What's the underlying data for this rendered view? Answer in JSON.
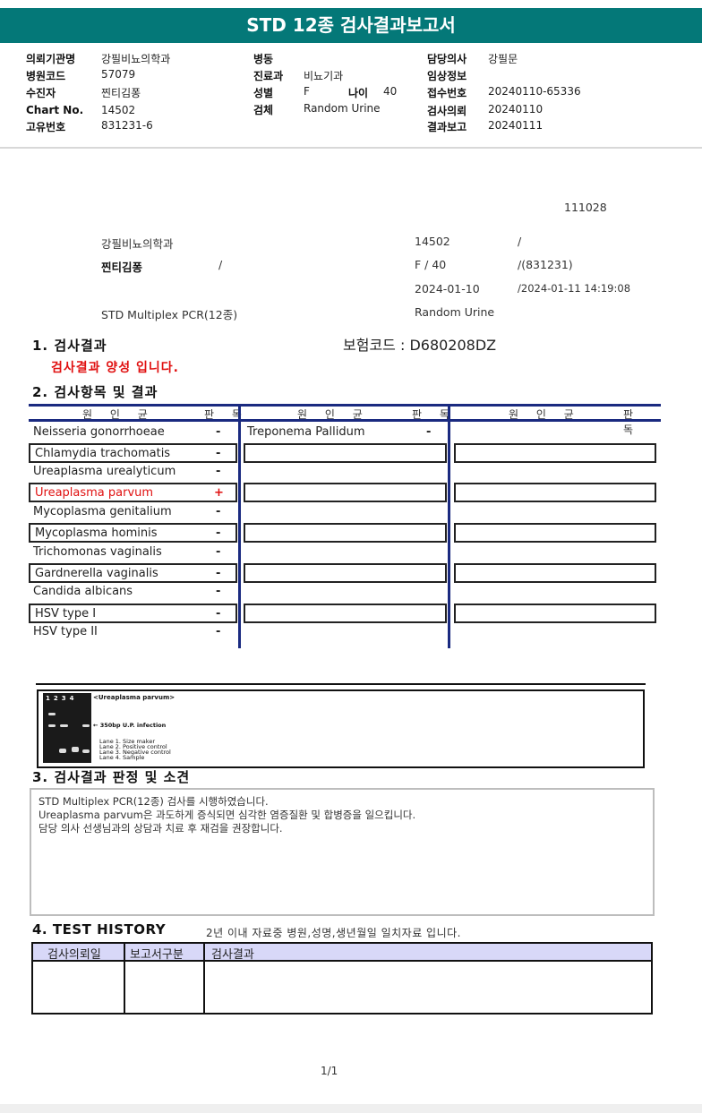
{
  "title": "STD 12종 검사결과보고서",
  "info": {
    "col1": [
      {
        "k": "의뢰기관명",
        "v": "강필비뇨의학과"
      },
      {
        "k": "병원코드",
        "v": "57079"
      },
      {
        "k": "수진자",
        "v": "찐티김퐁"
      },
      {
        "k": "Chart No.",
        "v": "14502"
      },
      {
        "k": "고유번호",
        "v": "831231-6"
      }
    ],
    "col2": [
      {
        "k": "병동",
        "v": ""
      },
      {
        "k": "진료과",
        "v": "비뇨기과"
      },
      {
        "k": "성별",
        "v": "F"
      },
      {
        "k": "검체",
        "v": "Random Urine"
      }
    ],
    "age": {
      "k": "나이",
      "v": "40"
    },
    "col3": [
      {
        "k": "담당의사",
        "v": "강필문"
      },
      {
        "k": "임상정보",
        "v": ""
      },
      {
        "k": "접수번호",
        "v": "20240110-65336"
      },
      {
        "k": "검사의뢰",
        "v": "20240110"
      },
      {
        "k": "결과보고",
        "v": "20240111"
      }
    ]
  },
  "sheet": {
    "code": "111028",
    "hospital": "강필비뇨의학과",
    "chart": "14502",
    "slash1": "/",
    "patient": "찐티김퐁",
    "slash2": "/",
    "sex_age": "F  /  40",
    "birth": "/(831231)",
    "request_date": "2024-01-10",
    "report_datetime": "/2024-01-11 14:19:08",
    "test_name": "STD Multiplex PCR(12종)",
    "specimen": "Random Urine"
  },
  "section1": {
    "title": "1. 검사결과",
    "insurance": "보험코드 : D680208DZ",
    "message": "검사결과 양성 입니다."
  },
  "section2": {
    "title": "2. 검사항목 및 결과",
    "header_pathogen": "원 인 균",
    "header_result": "판 독",
    "rows": [
      {
        "name": "Neisseria gonorrhoeae",
        "result": "-"
      },
      {
        "name": "Chlamydia trachomatis",
        "result": "-"
      },
      {
        "name": "Ureaplasma urealyticum",
        "result": "-"
      },
      {
        "name": "Ureaplasma parvum",
        "result": "+"
      },
      {
        "name": "Mycoplasma genitalium",
        "result": "-"
      },
      {
        "name": "Mycoplasma hominis",
        "result": "-"
      },
      {
        "name": "Trichomonas vaginalis",
        "result": "-"
      },
      {
        "name": "Gardnerella vaginalis",
        "result": "-"
      },
      {
        "name": "Candida albicans",
        "result": "-"
      },
      {
        "name": "HSV type I",
        "result": "-"
      },
      {
        "name": "HSV type II",
        "result": "-"
      }
    ],
    "col2_rows": [
      {
        "name": "Treponema Pallidum",
        "result": "-"
      }
    ]
  },
  "gel": {
    "lanes": "1234",
    "caption": "<Ureaplasma parvum>",
    "band_note": "← 350bp U.P. infection",
    "legend": [
      "Lane 1. Size maker",
      "Lane 2. Positive control",
      "Lane 3. Negative control",
      "Lane 4. Sample"
    ]
  },
  "section3": {
    "title": "3. 검사결과 판정 및 소견",
    "lines": [
      "STD Multiplex PCR(12종) 검사를 시행하였습니다.",
      "Ureaplasma parvum은  과도하게 증식되면 심각한 염증질환 및 합병증을 일으킵니다.",
      "담당 의사 선생님과의 상담과 치료 후 재검을 권장합니다."
    ]
  },
  "section4": {
    "title": "4. TEST HISTORY",
    "note": "2년 이내 자료중 병원,성명,생년월일 일치자료 입니다.",
    "headers": [
      "검사의뢰일",
      "보고서구분",
      "검사결과"
    ]
  },
  "pager": "1/1",
  "colors": {
    "title_bar": "#047878",
    "grid_line": "#1a2a80",
    "positive": "#e01010",
    "history_header": "#d8d8f8"
  }
}
